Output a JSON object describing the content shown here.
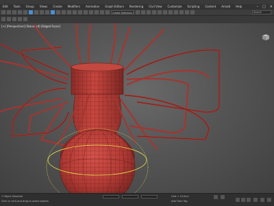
{
  "menu": {
    "items": [
      "Edit",
      "Tools",
      "Group",
      "Views",
      "Create",
      "Modifiers",
      "Animation",
      "Graph Editors",
      "Rendering",
      "Civil View",
      "Customize",
      "Scripting",
      "Content",
      "Arnold",
      "Help"
    ]
  },
  "toolbar": {
    "selection_set_placeholder": "Create Selection Set"
  },
  "search": {
    "placeholder": "Search"
  },
  "viewport": {
    "label": "[+] [Perspective] [Standard] [Edged Faces]"
  },
  "status": {
    "selected": "1 Object Selected",
    "hint": "Click or click-and-drag to select objects",
    "grid": "Grid = 10.0cm",
    "add_time_tag": "Add Time Tag"
  },
  "colors": {
    "mesh": "#b23b35",
    "accent": "#4b8fd6"
  }
}
